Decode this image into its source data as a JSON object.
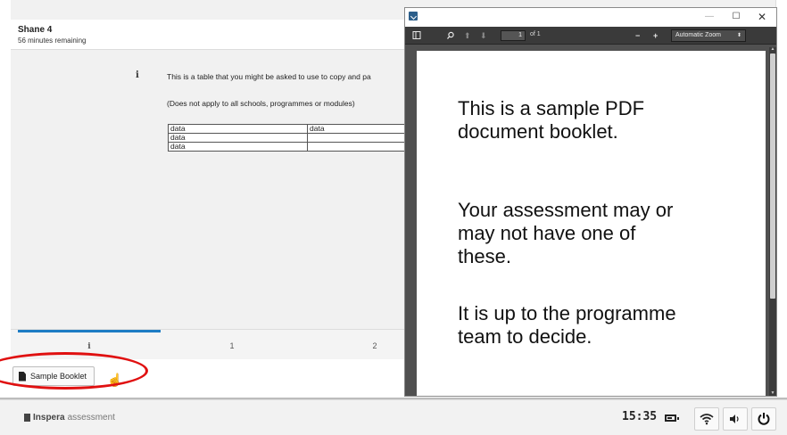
{
  "exam": {
    "candidate_name": "Shane 4",
    "time_remaining": "56 minutes remaining",
    "question_text": "This is a table that you might be asked to use to copy and pa",
    "question_note": "(Does not apply to all schools, programmes or modules)",
    "table": [
      [
        "data",
        "data"
      ],
      [
        "data",
        ""
      ],
      [
        "data",
        ""
      ]
    ],
    "tabs": [
      {
        "label": "i",
        "active": true
      },
      {
        "label": "1",
        "active": false
      },
      {
        "label": "2",
        "active": false
      }
    ],
    "resource_button": "Sample Booklet"
  },
  "pdf_viewer": {
    "page_number": "1",
    "page_count_text": "of 1",
    "zoom": "Automatic Zoom",
    "content": [
      [
        "This is a sample PDF",
        "document booklet."
      ],
      [
        "Your assessment may or",
        "may not have one of",
        "these."
      ],
      [
        "It is up to the programme",
        "team to decide."
      ]
    ]
  },
  "taskbar": {
    "brand_bold": "Inspera",
    "brand_light": "assessment",
    "clock": "15:35"
  },
  "colors": {
    "accent": "#1d7cc4",
    "highlight": "#e01010",
    "viewer_bg": "#505050"
  },
  "icons": [
    "info-icon",
    "document-icon",
    "hand-cursor-icon",
    "sidebar-toggle-icon",
    "search-icon",
    "up-arrow-icon",
    "down-arrow-icon",
    "minus-icon",
    "plus-icon",
    "minimize-icon",
    "maximize-icon",
    "close-icon",
    "battery-icon",
    "wifi-icon",
    "volume-icon",
    "power-icon"
  ]
}
